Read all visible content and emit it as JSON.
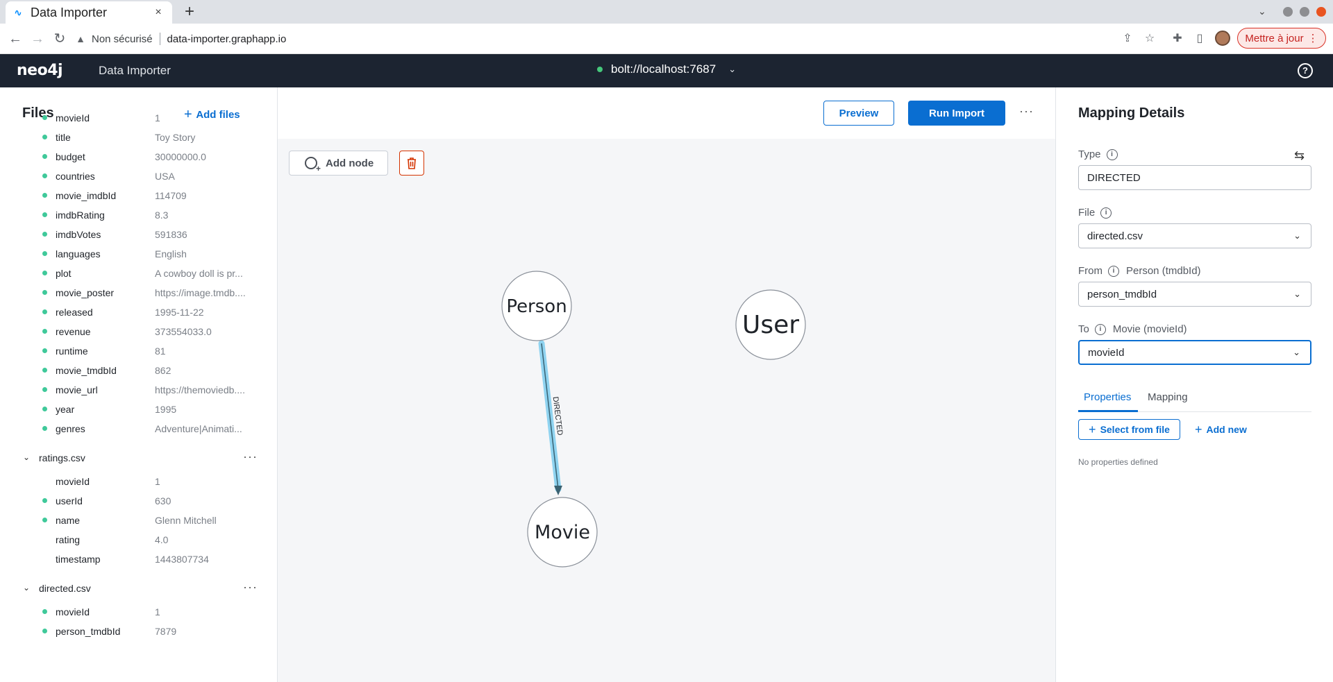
{
  "browser": {
    "tab_title": "Data Importer",
    "tab_close": "×",
    "new_tab": "+",
    "tab_menu": "⌄",
    "nav": {
      "back": "←",
      "forward": "→",
      "reload": "↻"
    },
    "security_label": "Non sécurisé",
    "url": "data-importer.graphapp.io",
    "update_label": "Mettre à jour",
    "update_menu": "⋮"
  },
  "app": {
    "logo": "neo4j",
    "name": "Data Importer",
    "connection": "bolt://localhost:7687",
    "connection_status_color": "#45c77b",
    "help": "?"
  },
  "files": {
    "title": "Files",
    "add_label": "Add files",
    "first_file_fields": [
      {
        "name": "movieId",
        "value": "1",
        "mapped": true
      },
      {
        "name": "title",
        "value": "Toy Story",
        "mapped": true
      },
      {
        "name": "budget",
        "value": "30000000.0",
        "mapped": true
      },
      {
        "name": "countries",
        "value": "USA",
        "mapped": true
      },
      {
        "name": "movie_imdbId",
        "value": "114709",
        "mapped": true
      },
      {
        "name": "imdbRating",
        "value": "8.3",
        "mapped": true
      },
      {
        "name": "imdbVotes",
        "value": "591836",
        "mapped": true
      },
      {
        "name": "languages",
        "value": "English",
        "mapped": true
      },
      {
        "name": "plot",
        "value": "A cowboy doll is pr...",
        "mapped": true
      },
      {
        "name": "movie_poster",
        "value": "https://image.tmdb....",
        "mapped": true
      },
      {
        "name": "released",
        "value": "1995-11-22",
        "mapped": true
      },
      {
        "name": "revenue",
        "value": "373554033.0",
        "mapped": true
      },
      {
        "name": "runtime",
        "value": "81",
        "mapped": true
      },
      {
        "name": "movie_tmdbId",
        "value": "862",
        "mapped": true
      },
      {
        "name": "movie_url",
        "value": "https://themoviedb....",
        "mapped": true
      },
      {
        "name": "year",
        "value": "1995",
        "mapped": true
      },
      {
        "name": "genres",
        "value": "Adventure|Animati...",
        "mapped": true
      }
    ],
    "ratings": {
      "name": "ratings.csv",
      "fields": [
        {
          "name": "movieId",
          "value": "1",
          "mapped": false
        },
        {
          "name": "userId",
          "value": "630",
          "mapped": true
        },
        {
          "name": "name",
          "value": "Glenn Mitchell",
          "mapped": true
        },
        {
          "name": "rating",
          "value": "4.0",
          "mapped": false
        },
        {
          "name": "timestamp",
          "value": "1443807734",
          "mapped": false
        }
      ]
    },
    "directed": {
      "name": "directed.csv",
      "fields": [
        {
          "name": "movieId",
          "value": "1",
          "mapped": true
        },
        {
          "name": "person_tmdbId",
          "value": "7879",
          "mapped": true
        }
      ]
    },
    "more": "···",
    "mapped_color": "#3fc99a"
  },
  "canvas": {
    "preview_label": "Preview",
    "run_label": "Run Import",
    "more": "···",
    "add_node_label": "Add node",
    "nodes": {
      "person": "Person",
      "user": "User",
      "movie": "Movie"
    },
    "relationship": "DIRECTED",
    "relationship_color": "#8fd3f0"
  },
  "details": {
    "title": "Mapping Details",
    "type_label": "Type",
    "type_value": "DIRECTED",
    "file_label": "File",
    "file_value": "directed.csv",
    "from_label": "From",
    "from_node": "Person (tmdbId)",
    "from_value": "person_tmdbId",
    "to_label": "To",
    "to_node": "Movie (movieId)",
    "to_value": "movieId",
    "tabs": [
      {
        "label": "Properties",
        "active": true
      },
      {
        "label": "Mapping",
        "active": false
      }
    ],
    "select_from_file_label": "Select from file",
    "add_new_label": "Add new",
    "empty_text": "No properties defined",
    "accent_color": "#0a6ed1"
  }
}
